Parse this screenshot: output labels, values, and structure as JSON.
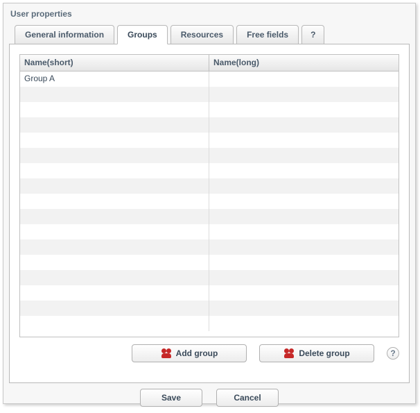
{
  "panel": {
    "title": "User properties"
  },
  "tabs": {
    "general": "General information",
    "groups": "Groups",
    "resources": "Resources",
    "free_fields": "Free fields",
    "help": "?"
  },
  "table": {
    "headers": {
      "short": "Name(short)",
      "long": "Name(long)"
    },
    "rows": [
      {
        "short": "Group A",
        "long": ""
      },
      {
        "short": "",
        "long": ""
      },
      {
        "short": "",
        "long": ""
      },
      {
        "short": "",
        "long": ""
      },
      {
        "short": "",
        "long": ""
      },
      {
        "short": "",
        "long": ""
      },
      {
        "short": "",
        "long": ""
      },
      {
        "short": "",
        "long": ""
      },
      {
        "short": "",
        "long": ""
      },
      {
        "short": "",
        "long": ""
      },
      {
        "short": "",
        "long": ""
      },
      {
        "short": "",
        "long": ""
      },
      {
        "short": "",
        "long": ""
      },
      {
        "short": "",
        "long": ""
      },
      {
        "short": "",
        "long": ""
      },
      {
        "short": "",
        "long": ""
      },
      {
        "short": "",
        "long": ""
      }
    ]
  },
  "actions": {
    "add_group": "Add group",
    "delete_group": "Delete group",
    "help_symbol": "?"
  },
  "footer": {
    "save": "Save",
    "cancel": "Cancel"
  }
}
